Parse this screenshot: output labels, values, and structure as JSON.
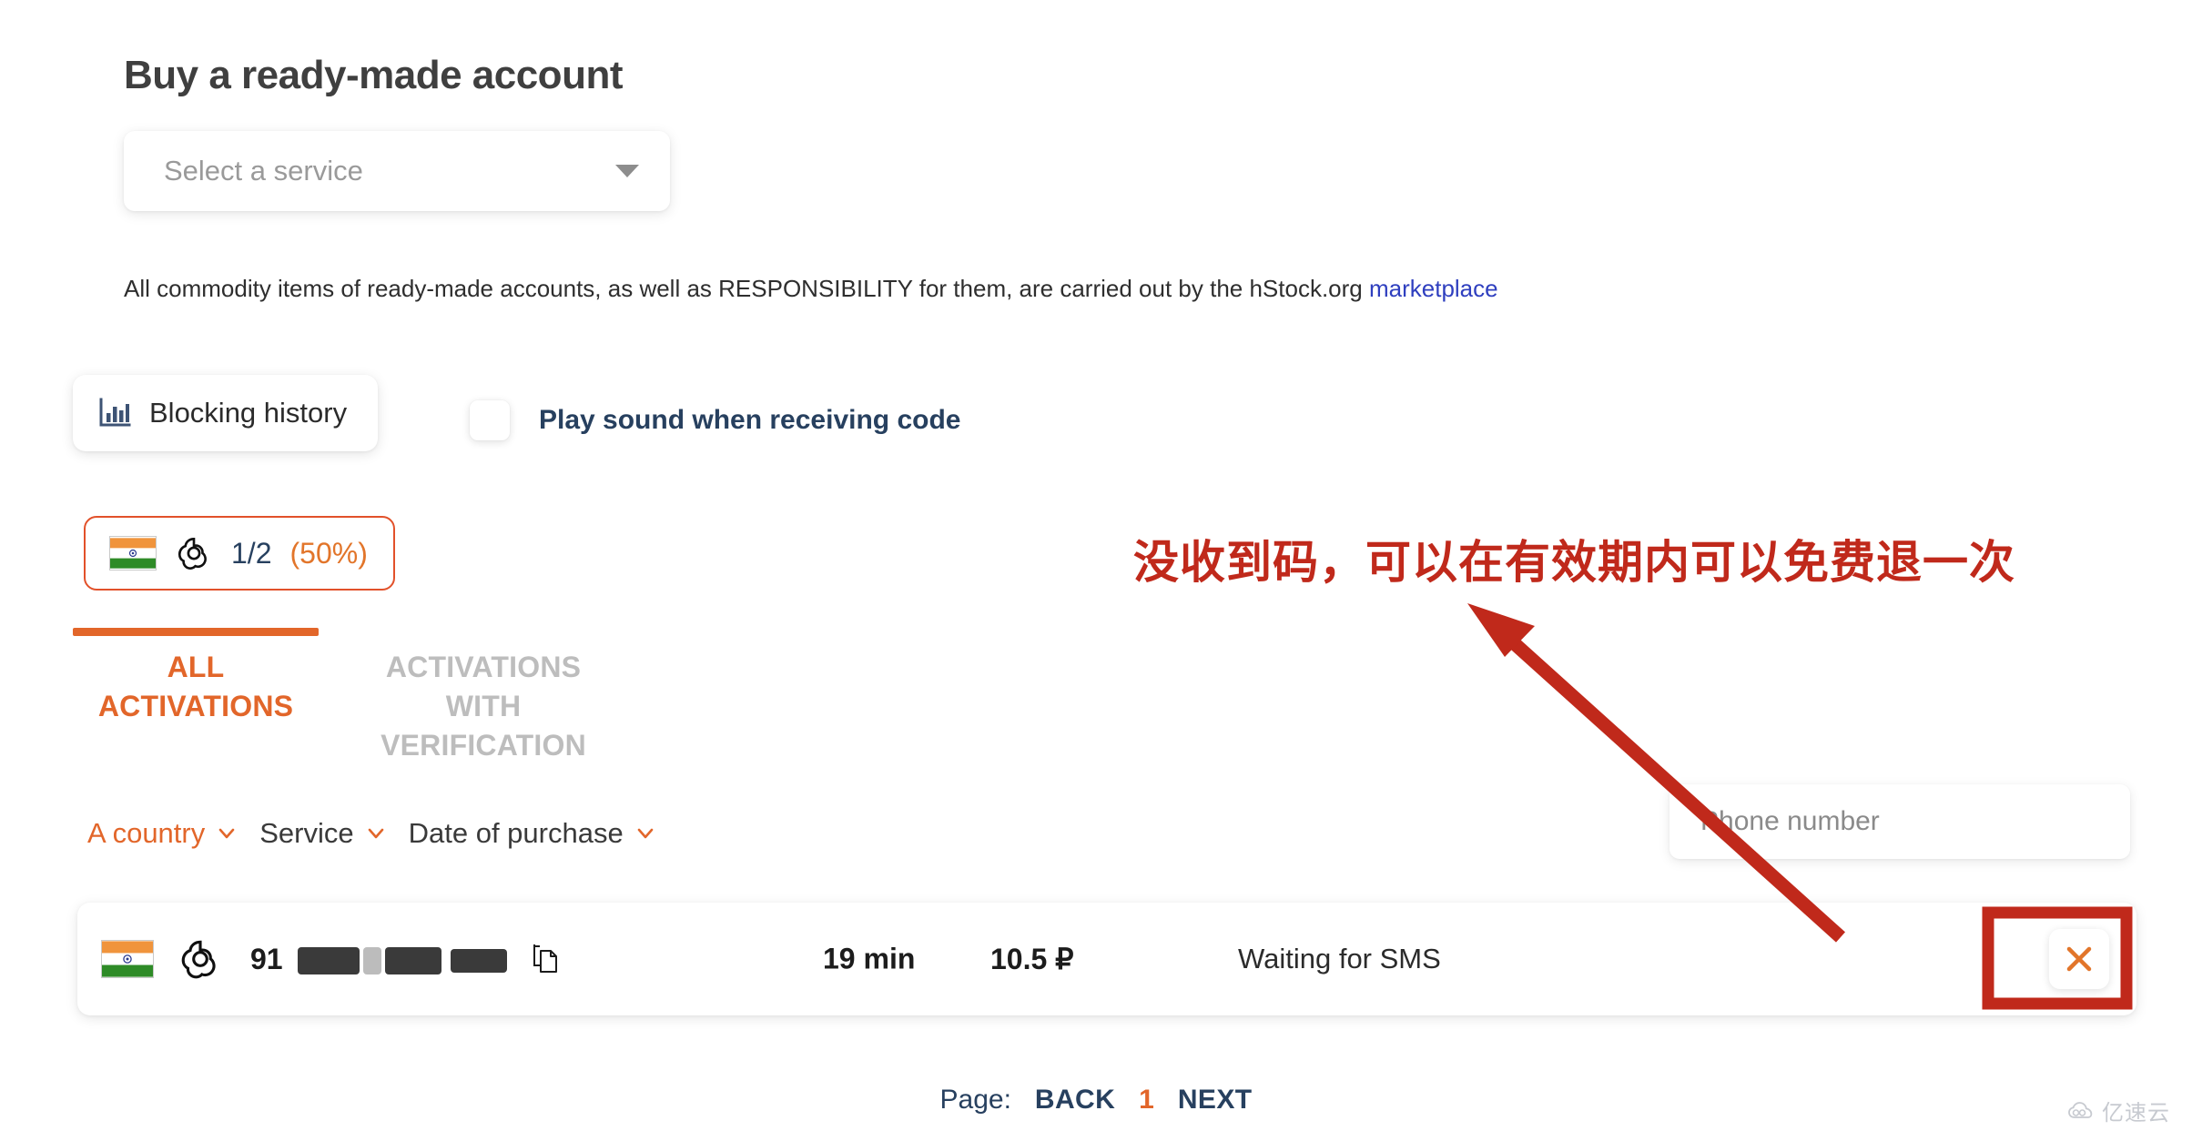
{
  "page": {
    "title": "Buy a ready-made account"
  },
  "service_select": {
    "placeholder": "Select a service",
    "icon": "chevron-down-icon"
  },
  "notice": {
    "text": "All commodity items of ready-made accounts, as well as RESPONSIBILITY for them, are carried out by the hStock.org ",
    "link_text": "marketplace"
  },
  "blocking_history": {
    "label": "Blocking history",
    "icon": "bar-chart-icon"
  },
  "sound_option": {
    "label": "Play sound when receiving code",
    "checked": false
  },
  "counter_badge": {
    "country_icon": "india-flag-icon",
    "service_icon": "openai-icon",
    "fraction": "1/2",
    "percent": "(50%)"
  },
  "tabs": [
    {
      "label": "ALL ACTIVATIONS",
      "active": true
    },
    {
      "label": "ACTIVATIONS WITH VERIFICATION",
      "active": false
    }
  ],
  "filters": [
    {
      "label": "A country",
      "active": true,
      "icon": "chevron-down-icon"
    },
    {
      "label": "Service",
      "active": false,
      "icon": "chevron-down-icon"
    },
    {
      "label": "Date of purchase",
      "active": false,
      "icon": "chevron-down-icon"
    }
  ],
  "phone_search": {
    "placeholder": "Phone number",
    "value": ""
  },
  "activation_row": {
    "country_icon": "india-flag-icon",
    "service_icon": "openai-icon",
    "phone_prefix": "91",
    "phone_redacted": true,
    "copy_icon": "copy-icon",
    "time_left": "19 min",
    "price": "10.5 ₽",
    "status": "Waiting for SMS",
    "cancel_icon": "close-icon"
  },
  "pagination": {
    "label": "Page:",
    "back": "BACK",
    "current": "1",
    "next": "NEXT"
  },
  "annotation": {
    "text": "没收到码，可以在有效期内可以免费退一次",
    "color": "#c0291b",
    "arrow": "red-arrow-pointing-up-left",
    "highlight_box": "red-rectangle-around-cancel-button"
  },
  "watermark": {
    "text": "亿速云",
    "icon": "cloud-icon"
  },
  "colors": {
    "accent_orange": "#e2662a",
    "navy": "#27405f",
    "link_blue": "#2f3fbf",
    "annotation_red": "#c0291b",
    "muted_gray": "#bdbdbd"
  }
}
